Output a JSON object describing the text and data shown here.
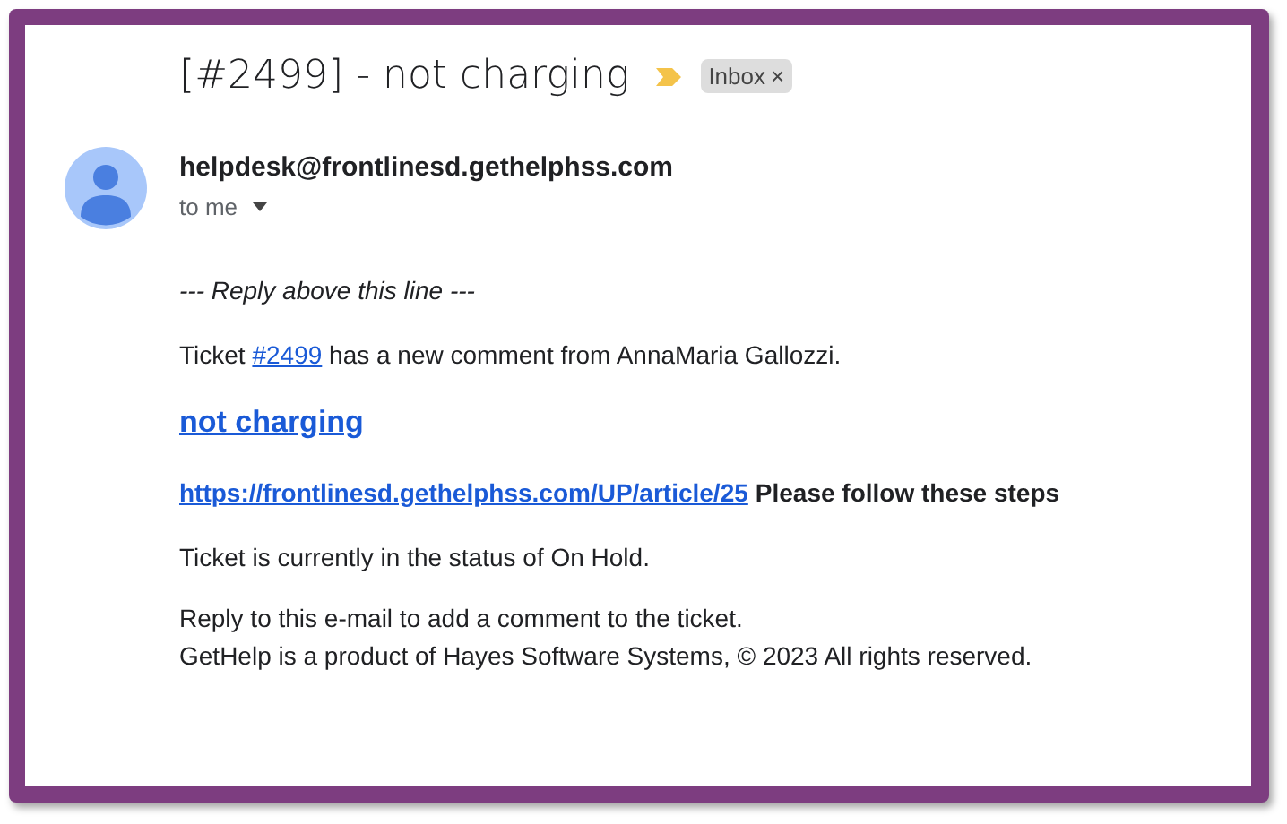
{
  "subject": "[#2499] - not charging",
  "label": {
    "text": "Inbox",
    "remove": "×"
  },
  "important": true,
  "sender": {
    "address": "helpdesk@frontlinesd.gethelphss.com",
    "recipient": "to me"
  },
  "body": {
    "separator": "--- Reply above this line ---",
    "comment": {
      "before": "Ticket ",
      "link": "#2499",
      "after": " has a new comment from AnnaMaria Gallozzi."
    },
    "title_link": "not charging",
    "article": {
      "link": "https://frontlinesd.gethelphss.com/UP/article/25",
      "text": "Please follow these steps"
    },
    "status": "Ticket is currently in the status of On Hold.",
    "footer": [
      "Reply to this e-mail to add a comment to the ticket.",
      "GetHelp is a product of Hayes Software Systems, © 2023 All rights reserved."
    ]
  }
}
